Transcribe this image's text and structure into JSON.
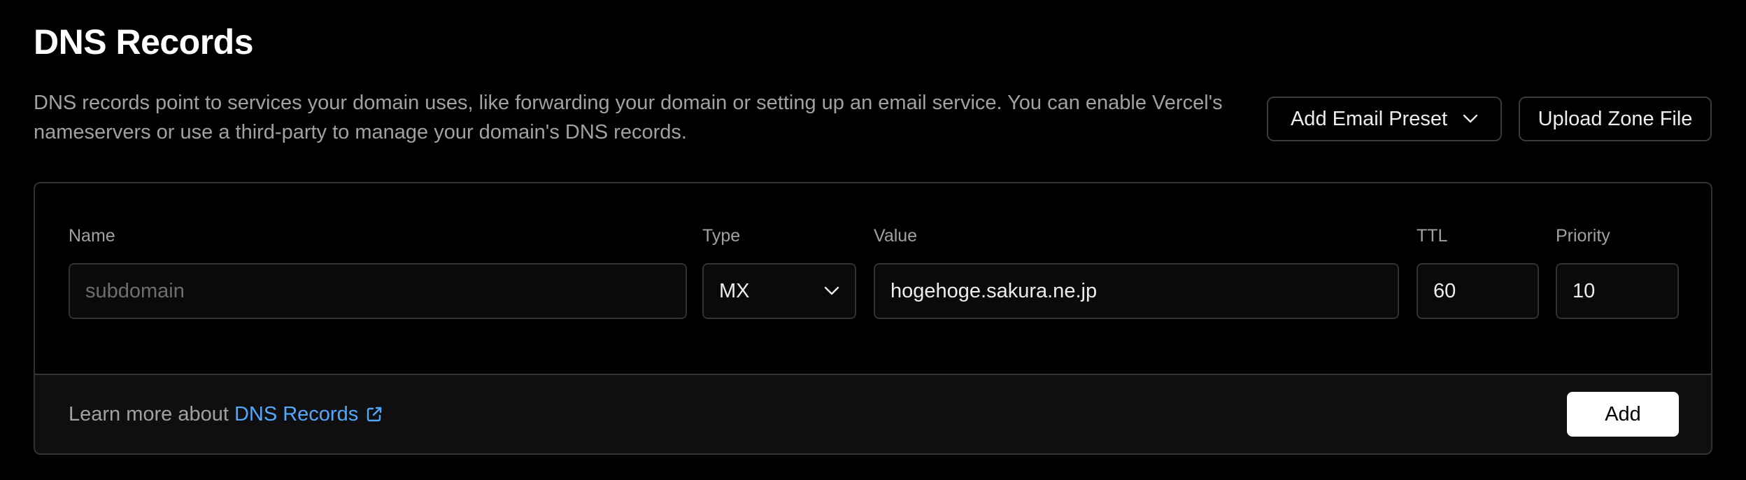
{
  "header": {
    "title": "DNS Records",
    "description": "DNS records point to services your domain uses, like forwarding your domain or setting up an email service. You can enable Vercel's nameservers or use a third-party to manage your domain's DNS records."
  },
  "actions": {
    "email_preset_label": "Add Email Preset",
    "upload_zone_label": "Upload Zone File"
  },
  "form": {
    "name": {
      "label": "Name",
      "value": "",
      "placeholder": "subdomain"
    },
    "type": {
      "label": "Type",
      "value": "MX"
    },
    "value": {
      "label": "Value",
      "value": "hogehoge.sakura.ne.jp"
    },
    "ttl": {
      "label": "TTL",
      "value": "60"
    },
    "priority": {
      "label": "Priority",
      "value": "10"
    }
  },
  "footer": {
    "learn_prefix": "Learn more about",
    "learn_link": "DNS Records",
    "add_label": "Add"
  },
  "icons": {
    "dropdown": "chevron-down-icon",
    "external": "external-link-icon"
  },
  "colors": {
    "background": "#000000",
    "link": "#52a8ff",
    "primary_button_bg": "#ffffff",
    "border": "#333333"
  }
}
